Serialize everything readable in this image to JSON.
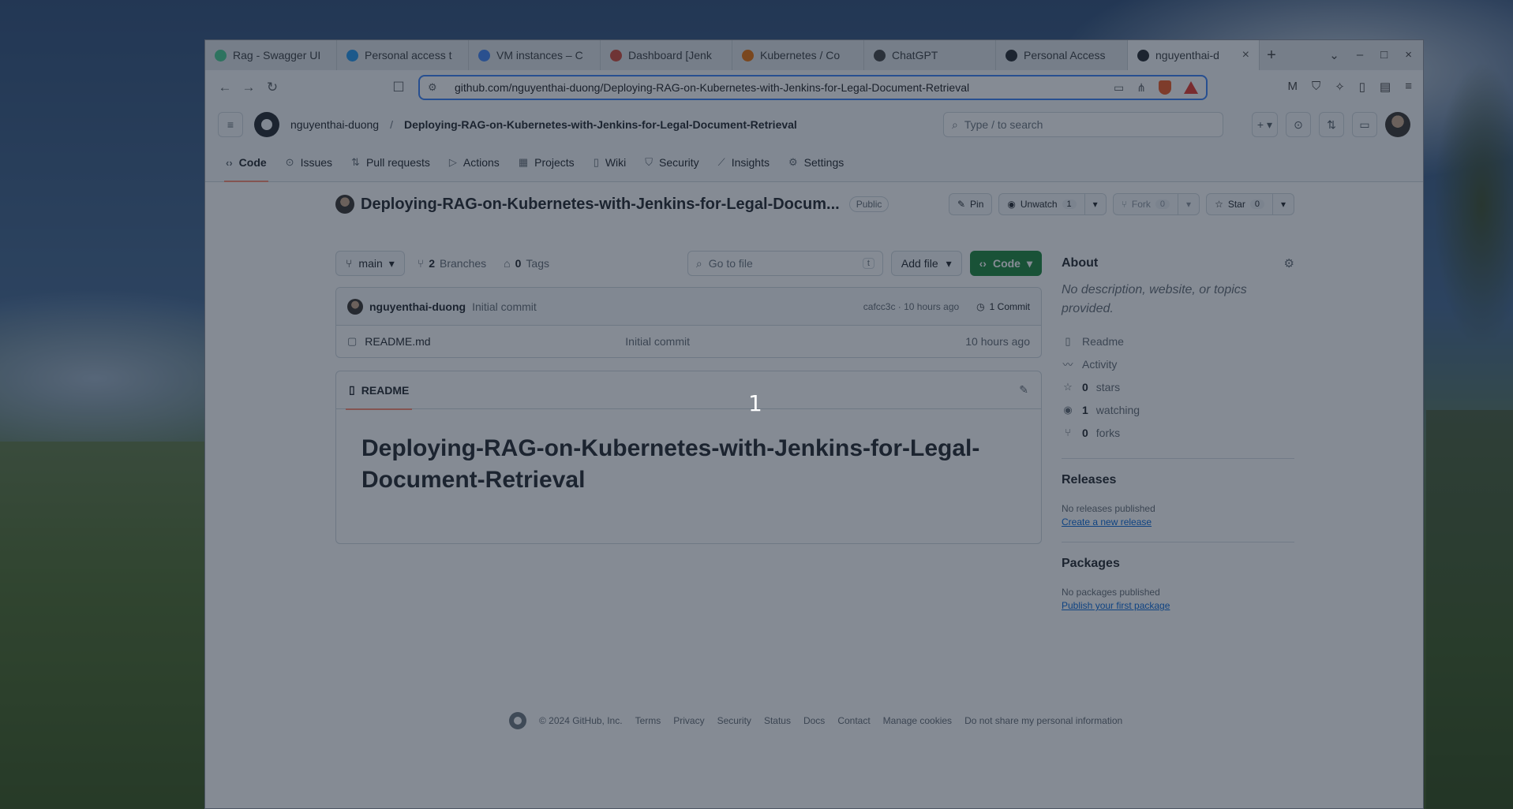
{
  "tabs": [
    {
      "label": "Rag - Swagger UI",
      "color": "#49cc90"
    },
    {
      "label": "Personal access t",
      "color": "#2496ed"
    },
    {
      "label": "VM instances – C",
      "color": "#4285f4"
    },
    {
      "label": "Dashboard [Jenk",
      "color": "#d24939"
    },
    {
      "label": "Kubernetes / Co",
      "color": "#e8710a"
    },
    {
      "label": "ChatGPT",
      "color": "#444444"
    },
    {
      "label": "Personal Access",
      "color": "#24292f"
    },
    {
      "label": "nguyenthai-d",
      "color": "#24292f",
      "active": true
    }
  ],
  "browser": {
    "url": "github.com/nguyenthai-duong/Deploying-RAG-on-Kubernetes-with-Jenkins-for-Legal-Document-Retrieval",
    "reward_badge": "1"
  },
  "header": {
    "owner": "nguyenthai-duong",
    "sep": "/",
    "repo": "Deploying-RAG-on-Kubernetes-with-Jenkins-for-Legal-Document-Retrieval",
    "search_placeholder": "Type / to search"
  },
  "repo_nav": [
    {
      "label": "Code",
      "icon": "code-icon",
      "active": true
    },
    {
      "label": "Issues",
      "icon": "issue-icon"
    },
    {
      "label": "Pull requests",
      "icon": "pull-request-icon"
    },
    {
      "label": "Actions",
      "icon": "play-icon"
    },
    {
      "label": "Projects",
      "icon": "table-icon"
    },
    {
      "label": "Wiki",
      "icon": "book-icon"
    },
    {
      "label": "Security",
      "icon": "shield-icon"
    },
    {
      "label": "Insights",
      "icon": "graph-icon"
    },
    {
      "label": "Settings",
      "icon": "gear-icon"
    }
  ],
  "repo": {
    "title": "Deploying-RAG-on-Kubernetes-with-Jenkins-for-Legal-Documents-Retrieval",
    "title_visible": "Deploying-RAG-on-Kubernetes-with-Jenkins-for-Legal-Docum...",
    "visibility": "Public",
    "pin_label": "Pin",
    "unwatch_label": "Unwatch",
    "unwatch_count": "1",
    "fork_label": "Fork",
    "fork_count": "0",
    "star_label": "Star",
    "star_count": "0"
  },
  "filebar": {
    "branch": "main",
    "branches_count": "2",
    "branches_label": "Branches",
    "tags_count": "0",
    "tags_label": "Tags",
    "goto_placeholder": "Go to file",
    "goto_key": "t",
    "add_file": "Add file",
    "code_btn": "Code"
  },
  "commit": {
    "author": "nguyenthai-duong",
    "message": "Initial commit",
    "meta": "cafcc3c · 10 hours ago",
    "count_label": "1 Commit"
  },
  "files": [
    {
      "name": "README.md",
      "commit": "Initial commit",
      "time": "10 hours ago"
    }
  ],
  "readme": {
    "tab_label": "README",
    "heading": "Deploying-RAG-on-Kubernetes-with-Jenkins-for-Legal-Document-Retrieval"
  },
  "about": {
    "title": "About",
    "description": "No description, website, or topics provided.",
    "readme": "Readme",
    "activity": "Activity",
    "stars_count": "0",
    "stars_label": "stars",
    "watching_count": "1",
    "watching_label": "watching",
    "forks_count": "0",
    "forks_label": "forks"
  },
  "releases": {
    "title": "Releases",
    "empty": "No releases published",
    "link": "Create a new release"
  },
  "packages": {
    "title": "Packages",
    "empty": "No packages published",
    "link": "Publish your first package"
  },
  "footer": {
    "copyright": "© 2024 GitHub, Inc.",
    "links": [
      "Terms",
      "Privacy",
      "Security",
      "Status",
      "Docs",
      "Contact",
      "Manage cookies",
      "Do not share my personal information"
    ]
  },
  "overlay": {
    "step_marker": "1"
  }
}
